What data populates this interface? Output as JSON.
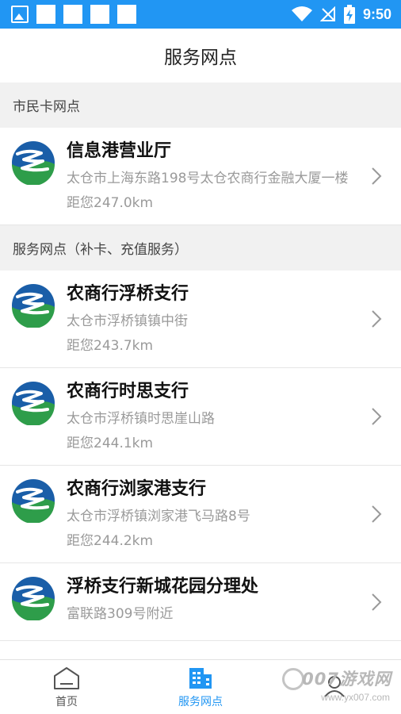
{
  "status_bar": {
    "time": "9:50"
  },
  "header": {
    "title": "服务网点"
  },
  "sections": [
    {
      "title": "市民卡网点",
      "items": [
        {
          "name": "信息港营业厅",
          "address": "太仓市上海东路198号太仓农商行金融大厦一楼",
          "distance": "距您247.0km"
        }
      ]
    },
    {
      "title": "服务网点（补卡、充值服务）",
      "items": [
        {
          "name": "农商行浮桥支行",
          "address": "太仓市浮桥镇镇中街",
          "distance": "距您243.7km"
        },
        {
          "name": "农商行时思支行",
          "address": "太仓市浮桥镇时思崖山路",
          "distance": "距您244.1km"
        },
        {
          "name": "农商行浏家港支行",
          "address": "太仓市浮桥镇浏家港飞马路8号",
          "distance": "距您244.2km"
        },
        {
          "name": "浮桥支行新城花园分理处",
          "address": "富联路309号附近",
          "distance": ""
        }
      ]
    }
  ],
  "tabs": [
    {
      "label": "首页",
      "icon": "home-icon",
      "active": false
    },
    {
      "label": "服务网点",
      "icon": "building-icon",
      "active": true
    },
    {
      "label": "",
      "icon": "user-icon",
      "active": false
    }
  ],
  "watermark": {
    "text": "007游戏网",
    "url": "www.yx007.com"
  },
  "colors": {
    "accent": "#2196f3",
    "logo_blue": "#1a5ea8",
    "logo_green": "#2e9d4a"
  }
}
